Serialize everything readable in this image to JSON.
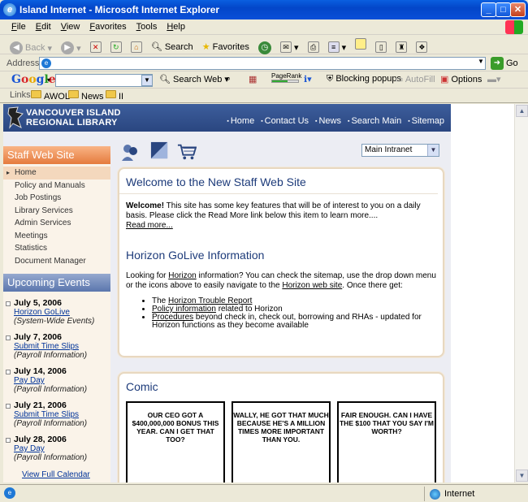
{
  "window": {
    "title": "Island Internet - Microsoft Internet Explorer"
  },
  "menu": [
    "File",
    "Edit",
    "View",
    "Favorites",
    "Tools",
    "Help"
  ],
  "toolbar": {
    "back": "Back",
    "search": "Search",
    "favorites": "Favorites"
  },
  "address": {
    "label": "Address",
    "value": "",
    "go": "Go"
  },
  "googlebar": {
    "logo": "Google",
    "search_web": "Search Web",
    "pagerank": "PageRank",
    "blocking": "Blocking popups",
    "autofill": "AutoFill",
    "options": "Options"
  },
  "links": {
    "label": "Links",
    "items": [
      "AWOL",
      "News",
      "II"
    ]
  },
  "site": {
    "name_line1": "VANCOUVER ISLAND",
    "name_line2": "REGIONAL LIBRARY",
    "topnav": [
      "Home",
      "Contact Us",
      "News",
      "Search Main",
      "Sitemap"
    ],
    "intranet_select": "Main Intranet"
  },
  "sidebar": {
    "staff_title": "Staff Web Site",
    "items": [
      "Home",
      "Policy and Manuals",
      "Job Postings",
      "Library Services",
      "Admin Services",
      "Meetings",
      "Statistics",
      "Document Manager"
    ],
    "events_title": "Upcoming Events",
    "events": [
      {
        "date": "July 5, 2006",
        "title": "Horizon GoLive",
        "category": "(System-Wide Events)"
      },
      {
        "date": "July 7, 2006",
        "title": "Submit Time Slips",
        "category": "(Payroll Information)"
      },
      {
        "date": "July 14, 2006",
        "title": "Pay Day",
        "category": "(Payroll Information)"
      },
      {
        "date": "July 21, 2006",
        "title": "Submit Time Slips",
        "category": "(Payroll Information)"
      },
      {
        "date": "July 28, 2006",
        "title": "Pay Day",
        "category": "(Payroll Information)"
      }
    ],
    "full_calendar": "View Full Calendar"
  },
  "welcome": {
    "title": "Welcome to the New Staff Web Site",
    "lead": "Welcome!",
    "text": " This site has some key features that will be of interest to you on a daily basis. Please click the Read More link below this item to learn more....",
    "read_more": "Read more...",
    "horizon_title": "Horizon GoLive Information",
    "h_t1": "Looking for ",
    "h_link1": "Horizon",
    "h_t2": " information? You can check the sitemap, use the drop down menu or the icons above to easily navigate to the ",
    "h_link2": "Horizon web site",
    "h_t3": ". Once there get:",
    "b1_pre": "The ",
    "b1_link": "Horizon Trouble Report",
    "b2_link": "Policy information",
    "b2_post": " related to Horizon",
    "b3_link": "Procedures",
    "b3_post": " beyond check in, check out, borrowing and RHAs - updated for Horizon functions as they become available"
  },
  "comic": {
    "title": "Comic",
    "panels": [
      "OUR CEO GOT A $400,000,000 BONUS THIS YEAR. CAN I GET THAT TOO?",
      "WALLY, HE GOT THAT MUCH BECAUSE HE'S A MILLION TIMES MORE IMPORTANT THAN YOU.",
      "FAIR ENOUGH. CAN I HAVE THE $100 THAT YOU SAY I'M WORTH?"
    ]
  },
  "status": {
    "zone": "Internet"
  }
}
